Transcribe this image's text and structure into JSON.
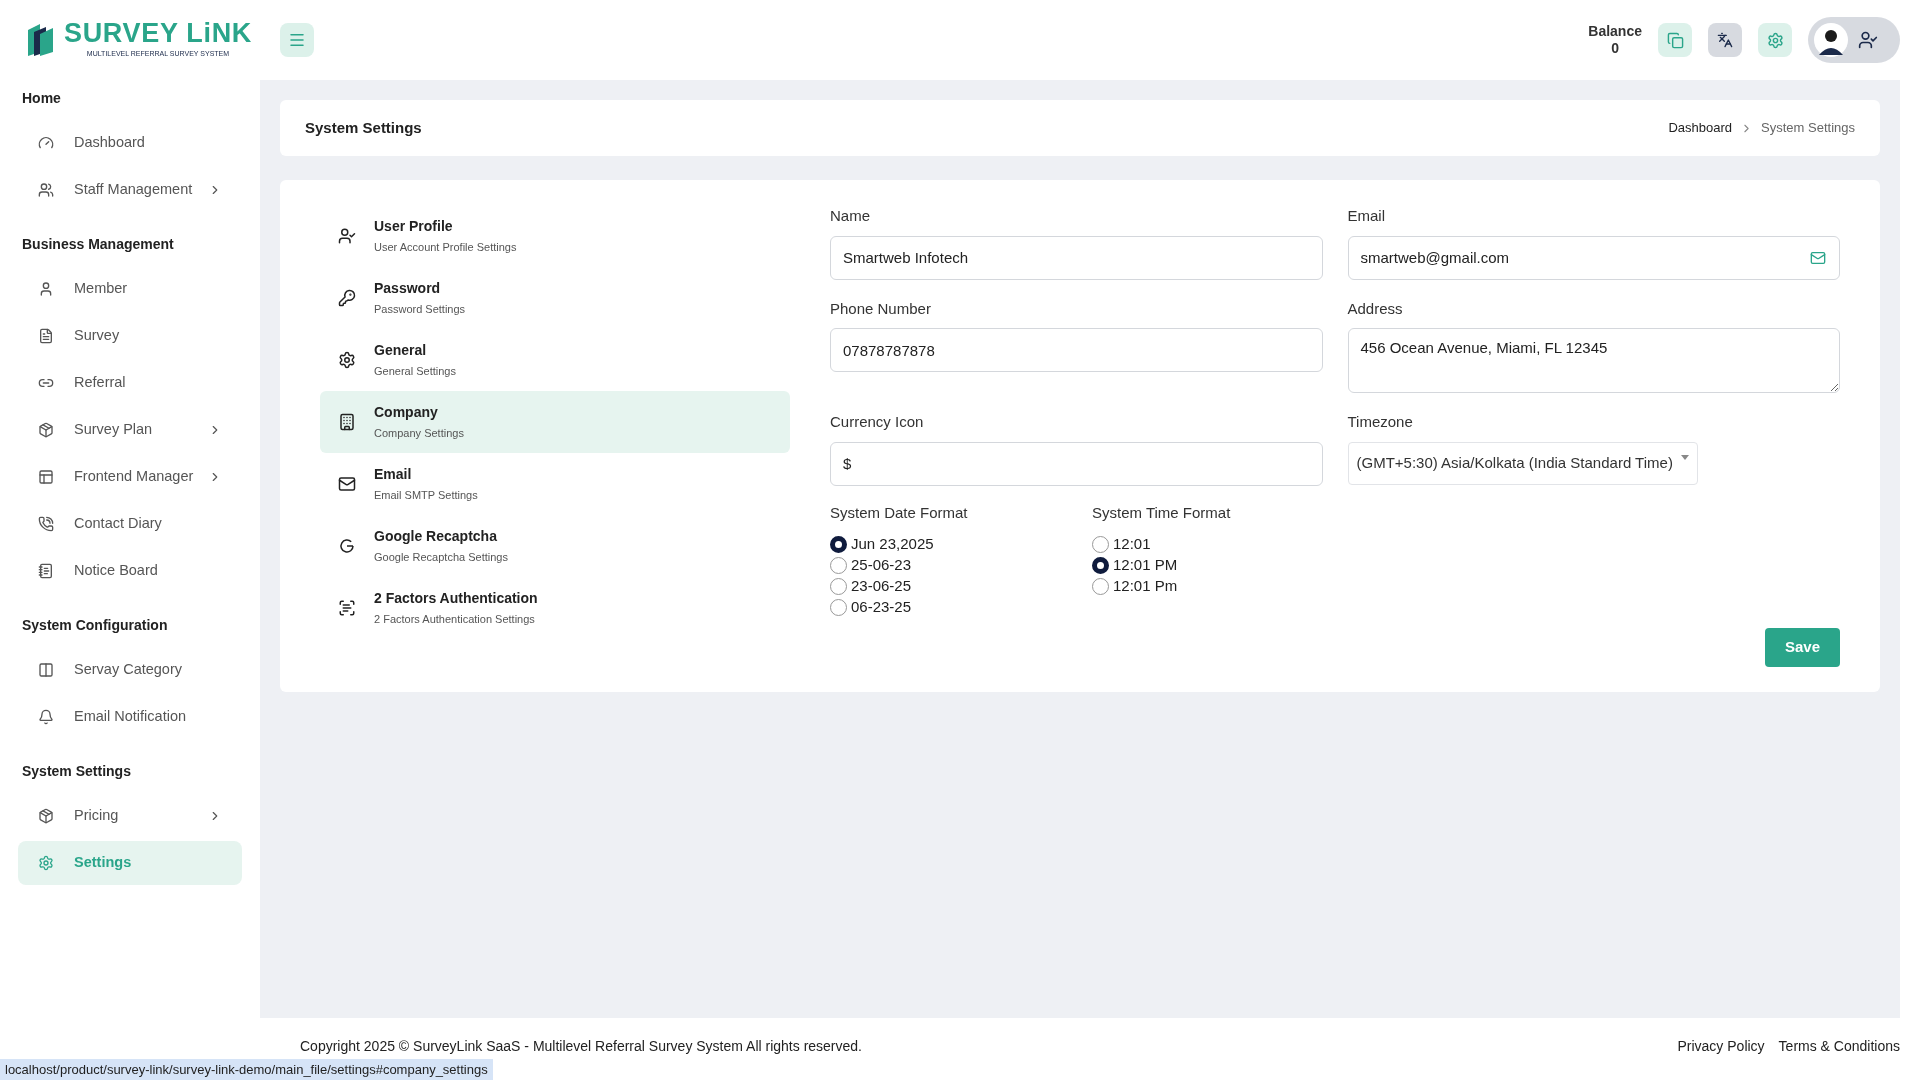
{
  "logo": {
    "title": "SURVEY LiNK",
    "tagline": "MULTILEVEL REFERRAL SURVEY SYSTEM"
  },
  "header": {
    "balance_label": "Balance",
    "balance_value": "0"
  },
  "sidebar": {
    "sections": [
      {
        "title": "Home",
        "items": [
          {
            "label": "Dashboard",
            "has_submenu": false,
            "selected": false
          },
          {
            "label": "Staff Management",
            "has_submenu": true,
            "selected": false
          }
        ]
      },
      {
        "title": "Business Management",
        "items": [
          {
            "label": "Member",
            "has_submenu": false,
            "selected": false
          },
          {
            "label": "Survey",
            "has_submenu": false,
            "selected": false
          },
          {
            "label": "Referral",
            "has_submenu": false,
            "selected": false
          },
          {
            "label": "Survey Plan",
            "has_submenu": true,
            "selected": false
          },
          {
            "label": "Frontend Manager",
            "has_submenu": true,
            "selected": false
          },
          {
            "label": "Contact Diary",
            "has_submenu": false,
            "selected": false
          },
          {
            "label": "Notice Board",
            "has_submenu": false,
            "selected": false
          }
        ]
      },
      {
        "title": "System Configuration",
        "items": [
          {
            "label": "Servay Category",
            "has_submenu": false,
            "selected": false
          },
          {
            "label": "Email Notification",
            "has_submenu": false,
            "selected": false
          }
        ]
      },
      {
        "title": "System Settings",
        "items": [
          {
            "label": "Pricing",
            "has_submenu": true,
            "selected": false
          },
          {
            "label": "Settings",
            "has_submenu": false,
            "selected": true
          }
        ]
      }
    ]
  },
  "page_header": {
    "title": "System Settings",
    "breadcrumb": [
      "Dashboard",
      "System Settings"
    ]
  },
  "settings_menu": [
    {
      "title": "User Profile",
      "subtitle": "User Account Profile Settings",
      "selected": false
    },
    {
      "title": "Password",
      "subtitle": "Password Settings",
      "selected": false
    },
    {
      "title": "General",
      "subtitle": "General Settings",
      "selected": false
    },
    {
      "title": "Company",
      "subtitle": "Company Settings",
      "selected": true
    },
    {
      "title": "Email",
      "subtitle": "Email SMTP Settings",
      "selected": false
    },
    {
      "title": "Google Recaptcha",
      "subtitle": "Google Recaptcha Settings",
      "selected": false
    },
    {
      "title": "2 Factors Authentication",
      "subtitle": "2 Factors Authentication Settings",
      "selected": false
    }
  ],
  "form": {
    "name": {
      "label": "Name",
      "value": "Smartweb Infotech"
    },
    "email": {
      "label": "Email",
      "value": "smartweb@gmail.com"
    },
    "phone": {
      "label": "Phone Number",
      "value": "07878787878"
    },
    "address": {
      "label": "Address",
      "value": "456 Ocean Avenue, Miami, FL 12345"
    },
    "currency": {
      "label": "Currency Icon",
      "value": "$"
    },
    "timezone": {
      "label": "Timezone",
      "value": "(GMT+5:30) Asia/Kolkata (India Standard Time)"
    },
    "date_format": {
      "label": "System Date Format",
      "options": [
        {
          "label": "Jun 23,2025",
          "selected": true
        },
        {
          "label": "25-06-23",
          "selected": false
        },
        {
          "label": "23-06-25",
          "selected": false
        },
        {
          "label": "06-23-25",
          "selected": false
        }
      ]
    },
    "time_format": {
      "label": "System Time Format",
      "options": [
        {
          "label": "12:01",
          "selected": false
        },
        {
          "label": "12:01 PM",
          "selected": true
        },
        {
          "label": "12:01 Pm",
          "selected": false
        }
      ]
    },
    "save_button": "Save"
  },
  "footer": {
    "copyright": "Copyright 2025 © SurveyLink SaaS - Multilevel Referral Survey System All rights reserved.",
    "links": [
      "Privacy Policy",
      "Terms & Conditions"
    ]
  },
  "status_url": "localhost/product/survey-link/survey-link-demo/main_file/settings#company_settings"
}
